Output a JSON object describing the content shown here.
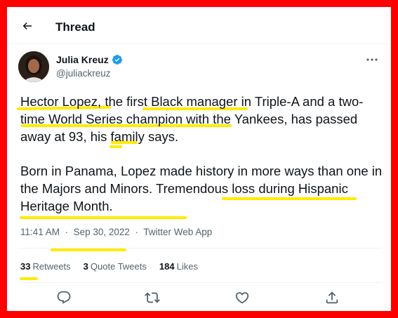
{
  "header": {
    "title": "Thread"
  },
  "author": {
    "name": "Julia Kreuz",
    "handle": "@juliackreuz"
  },
  "tweet": {
    "paragraphs": [
      "Hector Lopez, the first Black manager in Triple-A and a two-time World Series champion with the Yankees, has passed away at 93, his family says.",
      "Born in Panama, Lopez made history in more ways than one in the Majors and Minors. Tremendous loss during Hispanic Heritage Month."
    ],
    "time": "11:41 AM",
    "date": "Sep 30, 2022",
    "source": "Twitter Web App",
    "separator": "·"
  },
  "stats": {
    "retweets_count": "33",
    "retweets_label": "Retweets",
    "quotes_count": "3",
    "quotes_label": "Quote Tweets",
    "likes_count": "184",
    "likes_label": "Likes"
  },
  "actions": [
    "reply-icon",
    "retweet-icon",
    "like-icon",
    "share-icon"
  ],
  "colors": {
    "frame": "#ff0000",
    "highlight": "#ffeb00",
    "verified": "#1d9bf0",
    "muted": "#536471"
  }
}
